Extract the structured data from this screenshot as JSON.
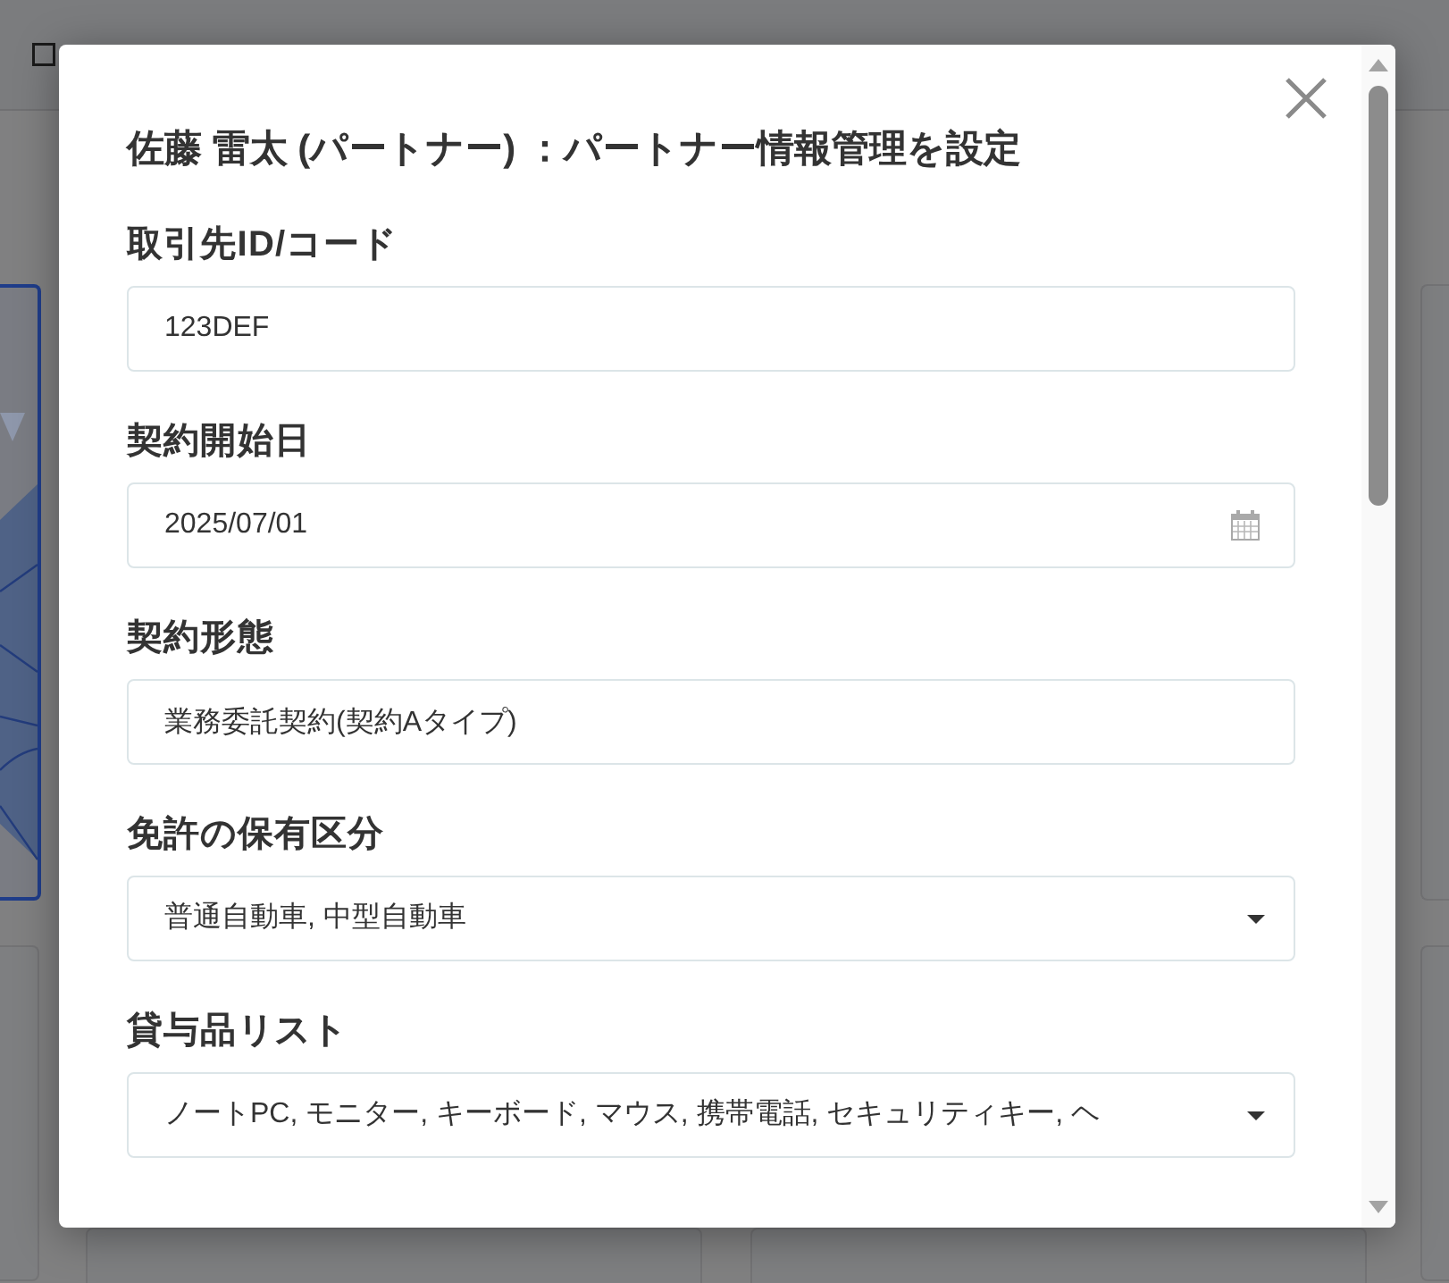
{
  "dialog": {
    "title": "佐藤 雷太 (パートナー) ：パートナー情報管理を設定",
    "fields": [
      {
        "kind": "text",
        "label": "取引先ID/コード",
        "value": "123DEF"
      },
      {
        "kind": "date",
        "label": "契約開始日",
        "value": "2025/07/01"
      },
      {
        "kind": "text",
        "label": "契約形態",
        "value": "業務委託契約(契約Aタイプ)"
      },
      {
        "kind": "select",
        "label": "免許の保有区分",
        "value": "普通自動車, 中型自動車"
      },
      {
        "kind": "select",
        "label": "貸与品リスト",
        "value": "ノートPC, モニター, キーボード, マウス, 携帯電話, セキュリティキー, ヘ"
      }
    ]
  }
}
